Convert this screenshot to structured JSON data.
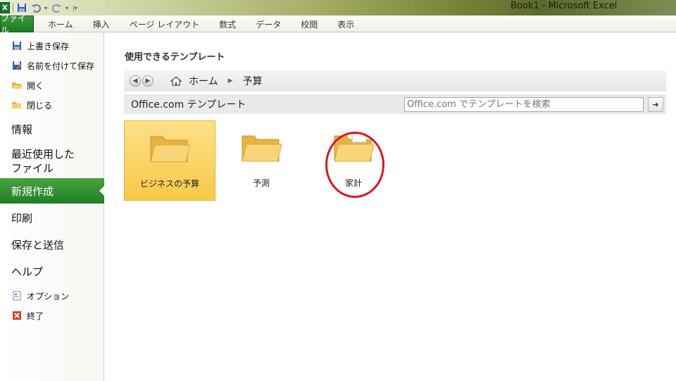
{
  "window": {
    "title": "Book1  -  Microsoft Excel",
    "app_logo": "X"
  },
  "qat": {
    "icons": [
      "save-icon",
      "undo-icon",
      "redo-icon",
      "customize-icon"
    ]
  },
  "ribbon": {
    "file_tab": "ファイル",
    "tabs": [
      "ホーム",
      "挿入",
      "ページ レイアウト",
      "数式",
      "データ",
      "校閲",
      "表示"
    ]
  },
  "sidebar": {
    "commands_top": [
      {
        "label": "上書き保存",
        "icon": "save-icon"
      },
      {
        "label": "名前を付けて保存",
        "icon": "save-as-icon"
      },
      {
        "label": "開く",
        "icon": "open-folder-icon"
      },
      {
        "label": "閉じる",
        "icon": "close-folder-icon"
      }
    ],
    "info": "情報",
    "recent_line1": "最近使用した",
    "recent_line2": "ファイル",
    "new": "新規作成",
    "print": "印刷",
    "save_send": "保存と送信",
    "help": "ヘルプ",
    "commands_bottom": [
      {
        "label": "オプション",
        "icon": "options-icon"
      },
      {
        "label": "終了",
        "icon": "exit-icon"
      }
    ]
  },
  "main": {
    "section_title": "使用できるテンプレート",
    "breadcrumb": {
      "home": "ホーム",
      "current": "予算"
    },
    "office_label": "Office.com テンプレート",
    "search_placeholder": "Office.com でテンプレートを検索",
    "templates": [
      {
        "label": "ビジネスの予算",
        "selected": true
      },
      {
        "label": "予測",
        "selected": false
      },
      {
        "label": "家計",
        "selected": false
      }
    ]
  },
  "colors": {
    "file_tab": "#1e7a22",
    "active_menu": "#207f25",
    "selected_tile": "#f7c94a",
    "highlight_circle": "#e0141c"
  }
}
